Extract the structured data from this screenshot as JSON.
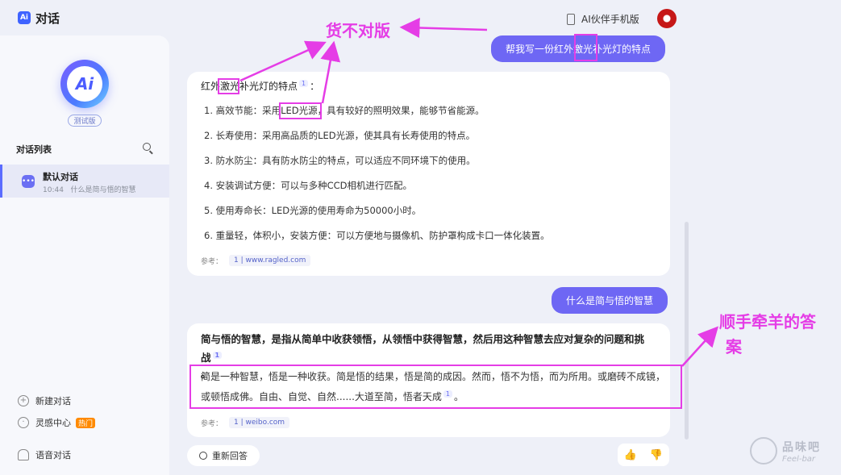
{
  "header": {
    "brand_icon": "Ai",
    "title": "对话",
    "mobile_link": "AI伙伴手机版"
  },
  "sidebar": {
    "logo_text": "Ai",
    "beta": "测试版",
    "list_title": "对话列表",
    "conversation": {
      "name": "默认对话",
      "time": "10:44",
      "preview": "什么是简与悟的智慧"
    },
    "menu": [
      {
        "icon": "plus-icon",
        "label": "新建对话"
      },
      {
        "icon": "bulb-icon",
        "label": "灵感中心",
        "badge": "热门"
      },
      {
        "icon": "headphone-icon",
        "label": "语音对话"
      }
    ]
  },
  "chat": {
    "user_message_1": "帮我写一份红外激光补光灯的特点",
    "answer_1": {
      "intro": "红外激光补光灯的特点",
      "intro_ref": "1",
      "intro_tail": "：",
      "points": [
        "1. 高效节能：采用LED光源，具有较好的照明效果，能够节省能源。",
        "2. 长寿使用：采用高品质的LED光源，使其具有长寿使用的特点。",
        "3. 防水防尘：具有防水防尘的特点，可以适应不同环境下的使用。",
        "4. 安装调试方便：可以与多种CCD相机进行匹配。",
        "5. 使用寿命长：LED光源的使用寿命为50000小时。",
        "6. 重量轻，体积小，安装方便：可以方便地与摄像机、防护罩构成卡口一体化装置。"
      ],
      "ref_label": "参考：",
      "ref_index": "1",
      "ref_site": "www.ragled.com"
    },
    "user_message_2": "什么是简与悟的智慧",
    "answer_2": {
      "title": "简与悟的智慧，是指从简单中收获领悟，从领悟中获得智慧，然后用这种智慧去应对复杂的问题和挑战",
      "title_ref": "1",
      "title_tail": "。",
      "body": "简是一种智慧，悟是一种收获。简是悟的结果，悟是简的成因。然而，悟不为悟，而为所用。或磨砖不成镜，或顿悟成佛。自由、自觉、自然......大道至简，悟者天成",
      "body_ref": "1",
      "body_tail": "。",
      "ref_label": "参考：",
      "ref_index": "1",
      "ref_site": "weibo.com"
    },
    "regenerate": "重新回答"
  },
  "annotations": {
    "label_1": "货不对版",
    "label_2_line1": "顺手牵羊的答",
    "label_2_line2": "案",
    "color": "#e53de6"
  },
  "watermark": {
    "cn": "品味吧",
    "en": "Feel-bar"
  }
}
